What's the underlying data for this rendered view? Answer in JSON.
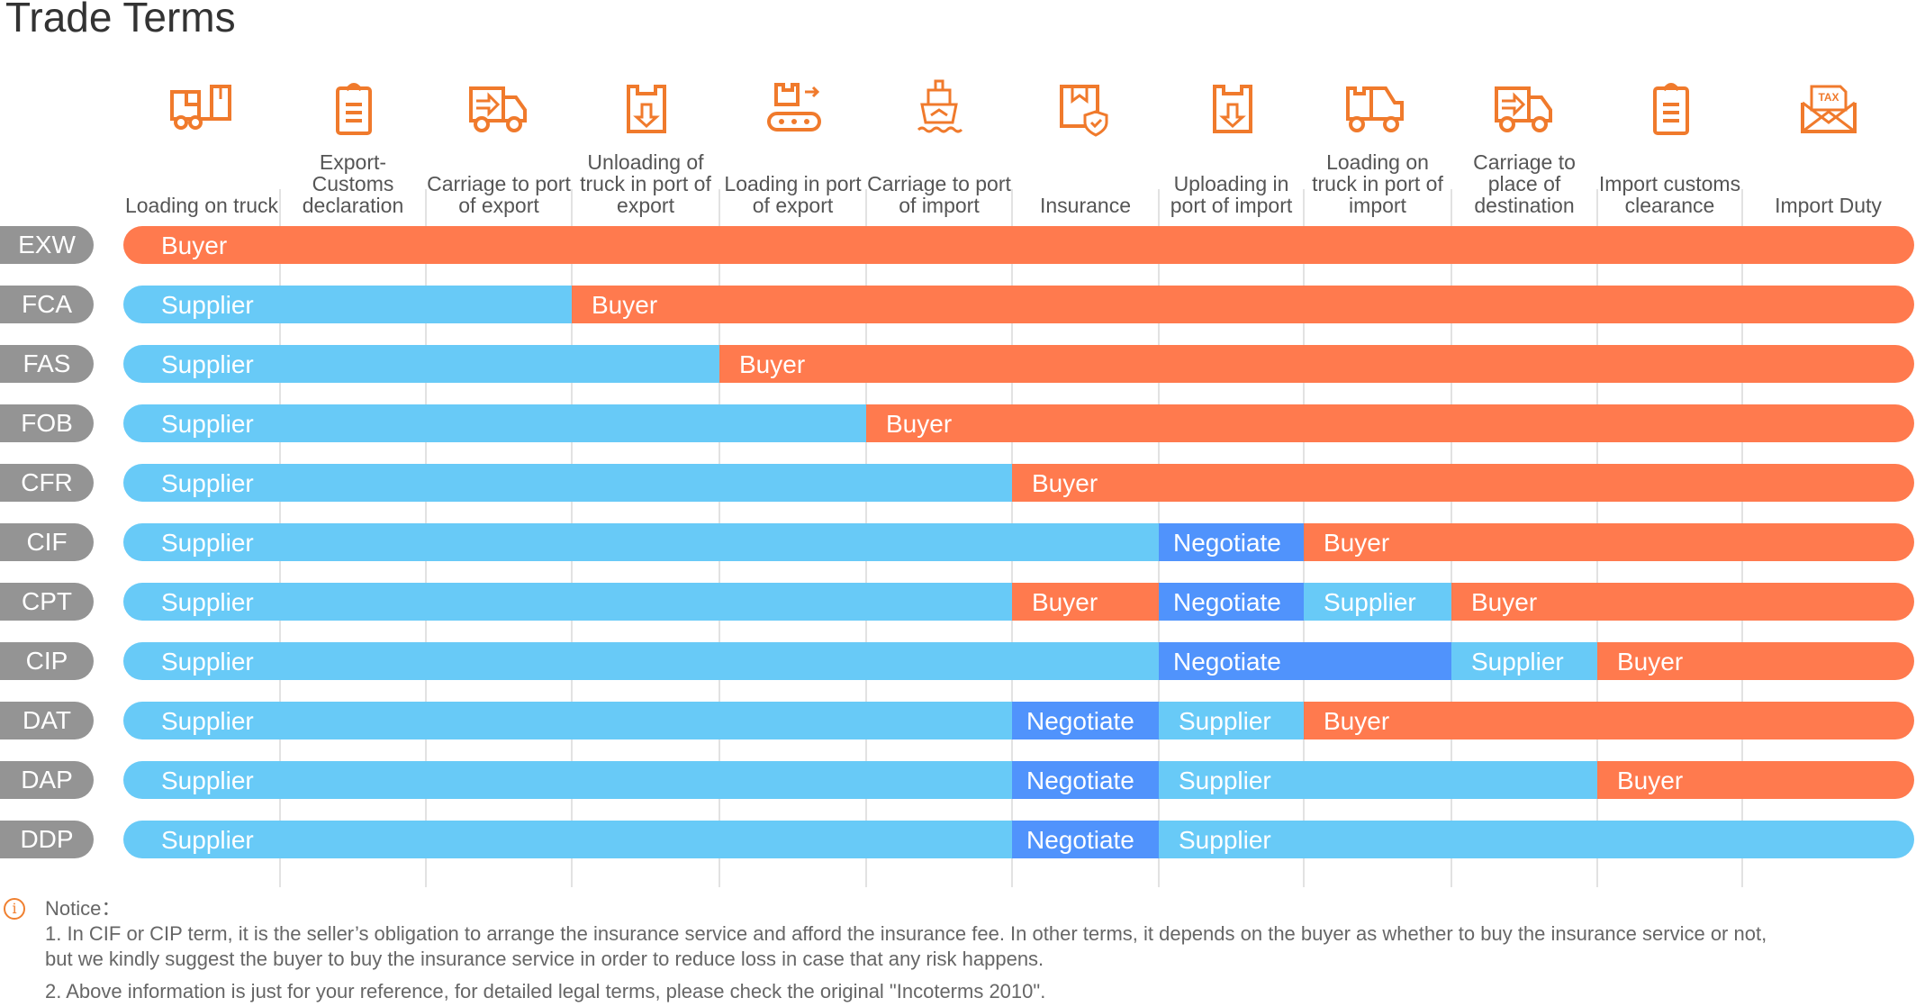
{
  "title": "Trade Terms",
  "colors": {
    "supplier": "#68CAF7",
    "buyer": "#FF7A4E",
    "negotiate": "#5093FC",
    "term_badge": "#949494",
    "icon": "#F07A2C"
  },
  "chart_data": {
    "type": "table",
    "title": "Trade Terms",
    "columns": [
      {
        "label": "Loading on truck",
        "icon": "forklift-truck-icon"
      },
      {
        "label": "Export-Customs declaration",
        "icon": "clipboard-icon"
      },
      {
        "label": "Carriage to port of export",
        "icon": "delivery-truck-icon"
      },
      {
        "label": "Unloading of truck in port of export",
        "icon": "box-unload-icon"
      },
      {
        "label": "Loading in port of export",
        "icon": "conveyor-icon"
      },
      {
        "label": "Carriage to port of import",
        "icon": "ship-icon"
      },
      {
        "label": "Insurance",
        "icon": "insured-box-icon"
      },
      {
        "label": "Uploading in port of import",
        "icon": "box-unload-icon"
      },
      {
        "label": "Loading on truck in port of import",
        "icon": "truck-cargo-icon"
      },
      {
        "label": "Carriage to place of destination",
        "icon": "delivery-truck-icon"
      },
      {
        "label": "Import customs clearance",
        "icon": "clipboard-icon"
      },
      {
        "label": "Import Duty",
        "icon": "tax-envelope-icon"
      }
    ],
    "legend": [
      "Supplier",
      "Buyer",
      "Negotiate"
    ],
    "rows": [
      {
        "term": "EXW",
        "segments": [
          {
            "party": "Buyer",
            "from": 0,
            "to": 12
          }
        ]
      },
      {
        "term": "FCA",
        "segments": [
          {
            "party": "Supplier",
            "from": 0,
            "to": 3
          },
          {
            "party": "Buyer",
            "from": 3,
            "to": 12
          }
        ]
      },
      {
        "term": "FAS",
        "segments": [
          {
            "party": "Supplier",
            "from": 0,
            "to": 4
          },
          {
            "party": "Buyer",
            "from": 4,
            "to": 12
          }
        ]
      },
      {
        "term": "FOB",
        "segments": [
          {
            "party": "Supplier",
            "from": 0,
            "to": 5
          },
          {
            "party": "Buyer",
            "from": 5,
            "to": 12
          }
        ]
      },
      {
        "term": "CFR",
        "segments": [
          {
            "party": "Supplier",
            "from": 0,
            "to": 6
          },
          {
            "party": "Buyer",
            "from": 6,
            "to": 12
          }
        ]
      },
      {
        "term": "CIF",
        "segments": [
          {
            "party": "Supplier",
            "from": 0,
            "to": 7
          },
          {
            "party": "Negotiate",
            "from": 7,
            "to": 8
          },
          {
            "party": "Buyer",
            "from": 8,
            "to": 12
          }
        ]
      },
      {
        "term": "CPT",
        "segments": [
          {
            "party": "Supplier",
            "from": 0,
            "to": 6
          },
          {
            "party": "Buyer",
            "from": 6,
            "to": 7
          },
          {
            "party": "Negotiate",
            "from": 7,
            "to": 8
          },
          {
            "party": "Supplier",
            "from": 8,
            "to": 9
          },
          {
            "party": "Buyer",
            "from": 9,
            "to": 12
          }
        ]
      },
      {
        "term": "CIP",
        "segments": [
          {
            "party": "Supplier",
            "from": 0,
            "to": 7
          },
          {
            "party": "Negotiate",
            "from": 7,
            "to": 9
          },
          {
            "party": "Supplier",
            "from": 9,
            "to": 10
          },
          {
            "party": "Buyer",
            "from": 10,
            "to": 12
          }
        ]
      },
      {
        "term": "DAT",
        "segments": [
          {
            "party": "Supplier",
            "from": 0,
            "to": 6
          },
          {
            "party": "Negotiate",
            "from": 6,
            "to": 7
          },
          {
            "party": "Supplier",
            "from": 7,
            "to": 8
          },
          {
            "party": "Buyer",
            "from": 8,
            "to": 12
          }
        ]
      },
      {
        "term": "DAP",
        "segments": [
          {
            "party": "Supplier",
            "from": 0,
            "to": 6
          },
          {
            "party": "Negotiate",
            "from": 6,
            "to": 7
          },
          {
            "party": "Supplier",
            "from": 7,
            "to": 10
          },
          {
            "party": "Buyer",
            "from": 10,
            "to": 12
          }
        ]
      },
      {
        "term": "DDP",
        "segments": [
          {
            "party": "Supplier",
            "from": 0,
            "to": 6
          },
          {
            "party": "Negotiate",
            "from": 6,
            "to": 7
          },
          {
            "party": "Supplier",
            "from": 7,
            "to": 12
          }
        ]
      }
    ]
  },
  "notice": {
    "heading": "Notice：",
    "line1a": "1. In CIF or CIP term, it is the seller’s obligation to arrange the insurance service and afford the insurance fee. In other terms, it depends on the buyer as whether to buy the insurance service or not,",
    "line1b": "but we kindly suggest the buyer to buy the insurance service in order to reduce loss in case that any risk happens.",
    "line2": "2. Above information is just for your reference, for detailed legal terms, please check the original \"Incoterms 2010\"."
  }
}
